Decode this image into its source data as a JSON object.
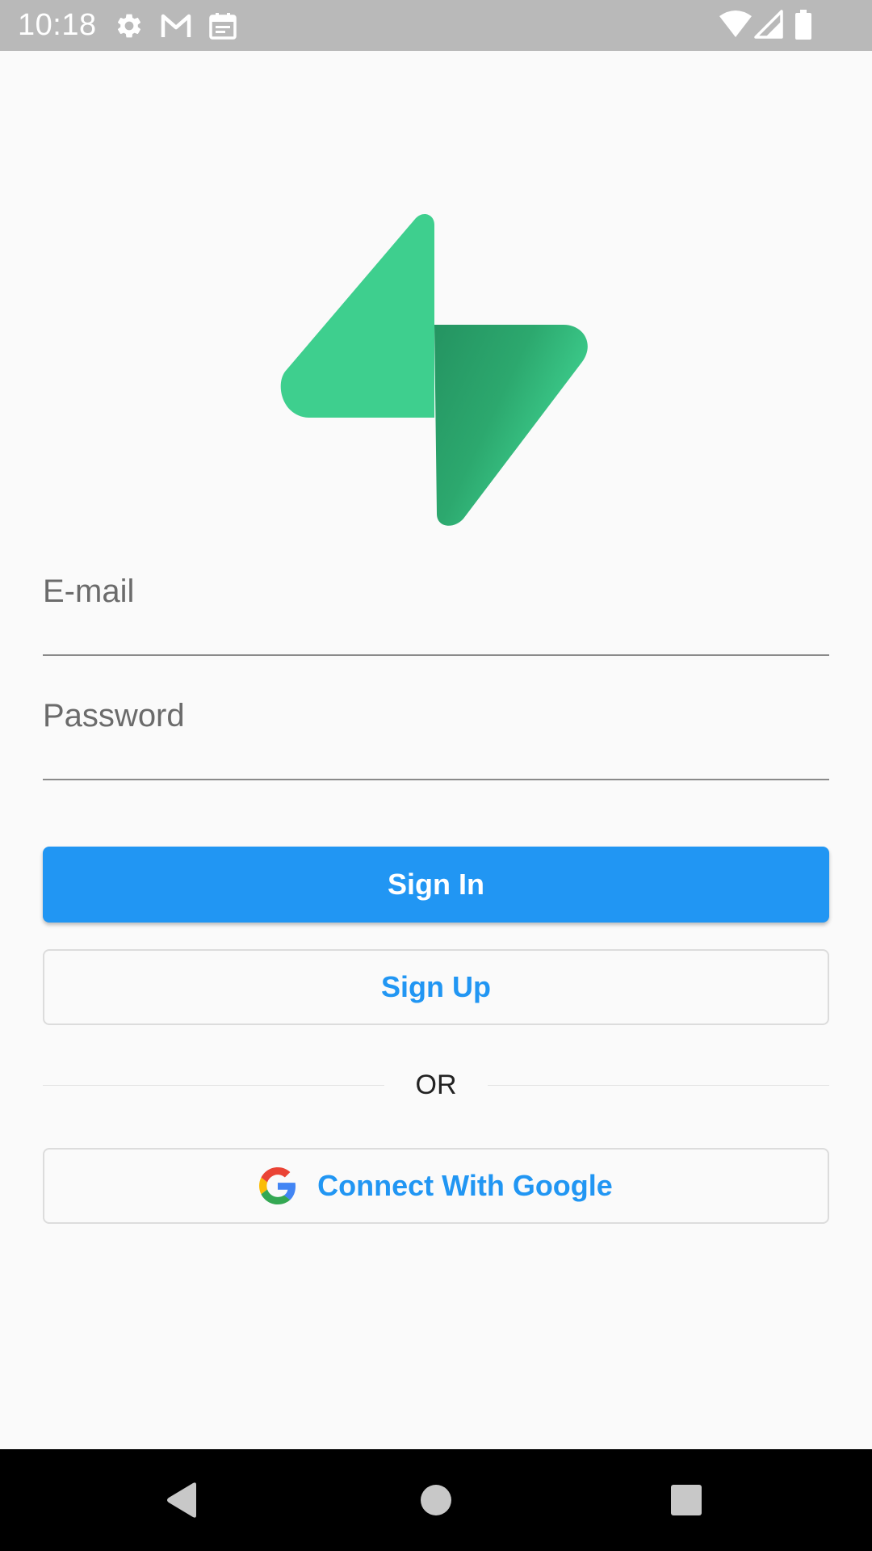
{
  "status_bar": {
    "time": "10:18",
    "icons": [
      "settings-icon",
      "gmail-icon",
      "calendar-icon",
      "wifi-icon",
      "cellular-signal-icon",
      "battery-icon"
    ]
  },
  "colors": {
    "status_bar_bg": "#b9b9b9",
    "background": "#fafafa",
    "primary": "#2196f3",
    "logo_green": "#3ecf8e",
    "logo_dark_green": "#249361",
    "nav_bar_bg": "#000000"
  },
  "logo": {
    "icon": "supabase-logo"
  },
  "form": {
    "email": {
      "label": "E-mail",
      "value": ""
    },
    "password": {
      "label": "Password",
      "value": ""
    }
  },
  "buttons": {
    "sign_in": "Sign In",
    "sign_up": "Sign Up",
    "google": "Connect With Google"
  },
  "divider": {
    "text": "OR"
  },
  "nav_bar": {
    "icons": [
      "back-icon",
      "home-icon",
      "recents-icon"
    ]
  }
}
